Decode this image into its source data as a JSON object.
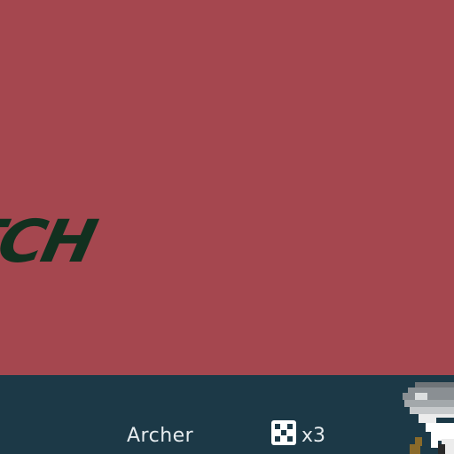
{
  "banner": {
    "text": "TCH",
    "text_color": "#12301f"
  },
  "colors": {
    "stage_background": "#a5474f",
    "bar_background": "#1c3947",
    "label_color": "#e6ecef",
    "dice_color": "#ffffff"
  },
  "unit": {
    "name": "Archer",
    "dice_icon": "dice-five-icon",
    "dice_count": "x3",
    "portrait_icon": "archer-portrait-icon"
  }
}
